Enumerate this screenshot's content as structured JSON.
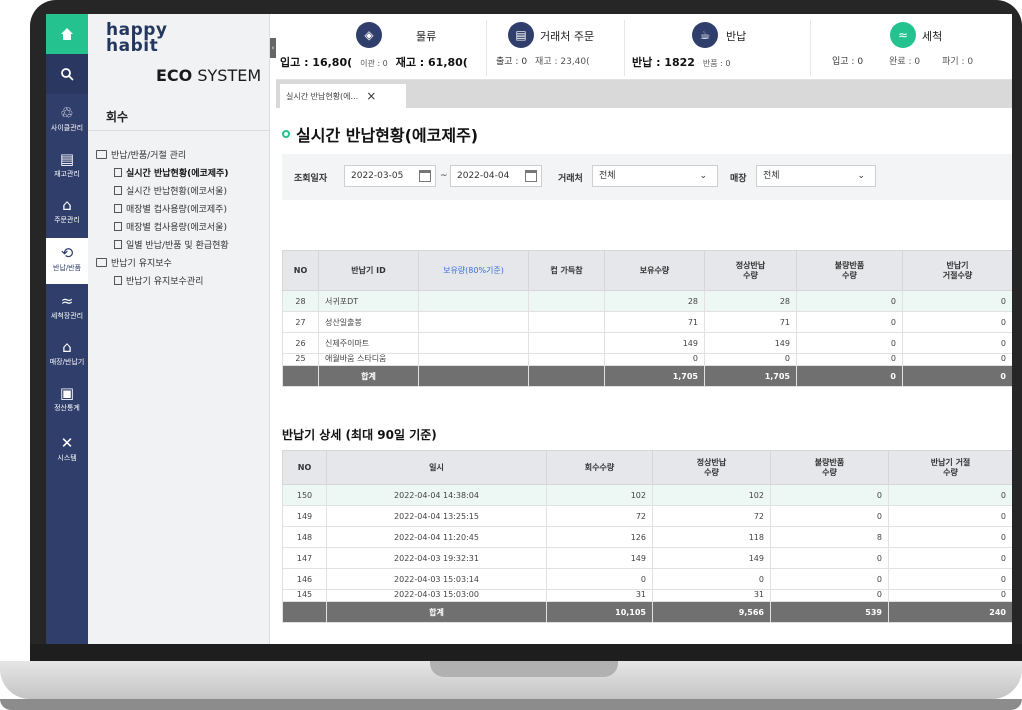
{
  "sidebar": {
    "items": [
      {
        "icon": "recycle-icon",
        "label": "사이클관리"
      },
      {
        "icon": "inventory-icon",
        "label": "재고관리"
      },
      {
        "icon": "store-icon",
        "label": "주문관리"
      },
      {
        "icon": "return-icon",
        "label": "반납/반품"
      },
      {
        "icon": "wash-icon",
        "label": "세척장관리"
      },
      {
        "icon": "store-return-icon",
        "label": "매장/반납기"
      },
      {
        "icon": "settlement-icon",
        "label": "정산통계"
      },
      {
        "icon": "tools-icon",
        "label": "시스템"
      }
    ]
  },
  "brand": {
    "line1": "happy",
    "line2": "habit",
    "eco_bold": "ECO",
    "eco_rest": " SYSTEM"
  },
  "menu": {
    "title": "회수",
    "groups": [
      {
        "label": "반납/반품/거절 관리"
      },
      {
        "label": "반납기 유지보수"
      }
    ],
    "items": [
      {
        "label": "실시간 반납현황(에코제주)"
      },
      {
        "label": "실시간 반납현황(에코서울)"
      },
      {
        "label": "매장별 컵사용량(에코제주)"
      },
      {
        "label": "매장별 컵사용량(에코서울)"
      },
      {
        "label": "일별 반납/반품 및 환급현황"
      },
      {
        "label": "반납기 유지보수관리"
      }
    ]
  },
  "stats": [
    {
      "title": "물류",
      "icon": "box-icon",
      "values": [
        {
          "label": "입고 : 16,80(",
          "big": true
        },
        {
          "label": "이관 : 0"
        },
        {
          "label": "재고 : 61,80(",
          "big": true
        }
      ]
    },
    {
      "title": "거래처 주문",
      "icon": "order-icon",
      "values": [
        {
          "label": "출고 : 0"
        },
        {
          "label": "재고 : 23,40("
        }
      ]
    },
    {
      "title": "반납",
      "icon": "cup-icon",
      "values": [
        {
          "label": "반납 : 1822",
          "big": true
        },
        {
          "label": "반품 : 0"
        }
      ]
    },
    {
      "title": "세척",
      "icon": "wash-icon",
      "values": [
        {
          "label": "입고 : 0"
        },
        {
          "label": "완료 : 0"
        },
        {
          "label": "파기 : 0"
        }
      ]
    }
  ],
  "tab": {
    "label": "실시간 반납현황(에...",
    "close": "×"
  },
  "page": {
    "title": "실시간 반납현황(에코제주)"
  },
  "filter": {
    "date_label": "조회일자",
    "date_from": "2022-03-05",
    "tilde": "~",
    "date_to": "2022-04-04",
    "partner_label": "거래처",
    "partner_value": "전체",
    "store_label": "매장",
    "store_value": "전체"
  },
  "table1": {
    "headers": [
      "NO",
      "반납기 ID",
      "보유량(80%기준)",
      "컵 가득참",
      "보유수량",
      "정상반납\n수량",
      "불량반품\n수량",
      "반납기\n거절수량"
    ],
    "rows": [
      [
        "28",
        "서귀포DT",
        "",
        "",
        "28",
        "28",
        "0",
        "0"
      ],
      [
        "27",
        "성산일출봉",
        "",
        "",
        "71",
        "71",
        "0",
        "0"
      ],
      [
        "26",
        "신제주이마트",
        "",
        "",
        "149",
        "149",
        "0",
        "0"
      ],
      [
        "25",
        "애월바움 스타디움",
        "",
        "",
        "0",
        "0",
        "0",
        "0"
      ]
    ],
    "sum": {
      "label": "합계",
      "held": "1,705",
      "normal": "1,705",
      "bad": "0",
      "rejected": "0"
    }
  },
  "section2": {
    "title": "반납기 상세 (최대 90일 기준)"
  },
  "table2": {
    "headers": [
      "NO",
      "일시",
      "회수수량",
      "정상반납\n수량",
      "불량반품\n수량",
      "반납기 거절\n수량"
    ],
    "rows": [
      [
        "150",
        "2022-04-04 14:38:04",
        "102",
        "102",
        "0",
        "0"
      ],
      [
        "149",
        "2022-04-04 13:25:15",
        "72",
        "72",
        "0",
        "0"
      ],
      [
        "148",
        "2022-04-04 11:20:45",
        "126",
        "118",
        "8",
        "0"
      ],
      [
        "147",
        "2022-04-03 19:32:31",
        "149",
        "149",
        "0",
        "0"
      ],
      [
        "146",
        "2022-04-03 15:03:14",
        "0",
        "0",
        "0",
        "0"
      ],
      [
        "145",
        "2022-04-03 15:03:00",
        "31",
        "31",
        "0",
        "0"
      ]
    ],
    "sum": {
      "label": "합계",
      "collected": "10,105",
      "normal": "9,566",
      "bad": "539",
      "rejected": "240"
    }
  },
  "colors": {
    "accent": "#23c28f",
    "nav": "#2f3e6b",
    "sum_row": "#707070",
    "link": "#3a6fd6"
  }
}
